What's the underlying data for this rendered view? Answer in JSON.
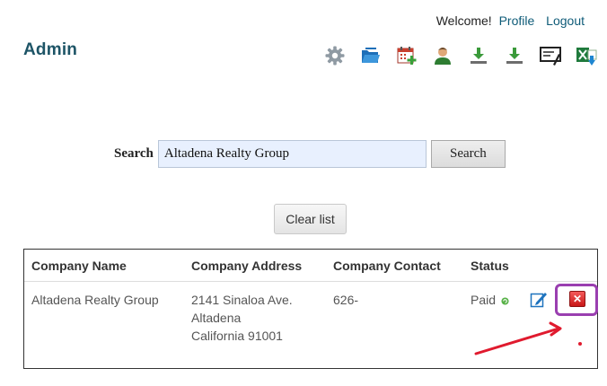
{
  "header": {
    "welcome_text": "Welcome!",
    "profile_link": "Profile",
    "logout_link": "Logout",
    "brand": "Admin"
  },
  "toolbar": {
    "icons": [
      "settings-gear-icon",
      "open-folder-icon",
      "add-calendar-icon",
      "user-icon",
      "download-icon",
      "download-icon",
      "signature-icon",
      "excel-export-icon"
    ]
  },
  "search": {
    "label": "Search",
    "value": "Altadena Realty Group",
    "button_label": "Search"
  },
  "clear_button_label": "Clear list",
  "table": {
    "columns": [
      "Company Name",
      "Company Address",
      "Company Contact",
      "Status"
    ],
    "rows": [
      {
        "company_name": "Altadena Realty Group",
        "address_line1": "2141 Sinaloa Ave.",
        "address_line2": "Altadena",
        "address_line3": "California 91001",
        "contact": "626-",
        "status": "Paid",
        "status_icon": "refresh-icon",
        "action_icons": [
          "edit-icon",
          "delete-icon"
        ]
      }
    ]
  },
  "colors": {
    "brand": "#1d5466",
    "link": "#0e5b78",
    "annotation_box": "#9a3fb0",
    "annotation_arrow": "#e01a2e",
    "delete_red": "#d32020"
  }
}
